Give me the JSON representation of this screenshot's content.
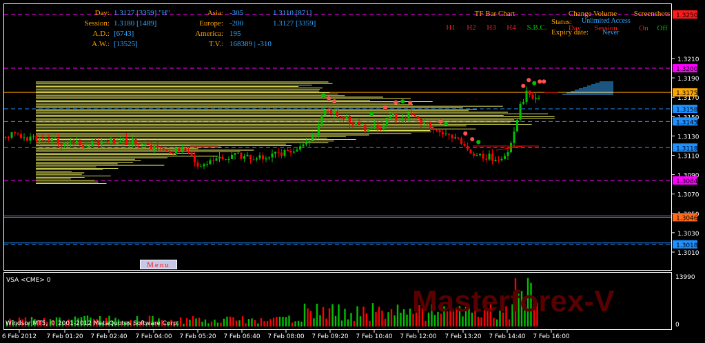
{
  "info_panel": {
    "day_label": "Day:",
    "day_value": "1.3127  [3359]  \"H\"",
    "session_label": "Session:",
    "session_value": "1.3180  [1489]",
    "ad_label": "A.D.:",
    "ad_value": "[6743]",
    "aw_label": "A.W.:",
    "aw_value": "[13525]",
    "asia_label": "Asia:",
    "asia_value": "-305",
    "asia_extra": "1.3110 [871]",
    "europe_label": "Europe:",
    "europe_value": "-200",
    "europe_extra": "1.3127 [3359]",
    "america_label": "America:",
    "america_value": "195",
    "tv_label": "T.V.:",
    "tv_value": "168389 | -310"
  },
  "tf_panel": {
    "title": "TF Bar Chart",
    "buttons": [
      "H1",
      "H2",
      "H3",
      "H4",
      "S.B.C."
    ]
  },
  "right_panel": {
    "change_volume": "Change Volume",
    "screenshots": "Screenshots",
    "status_label": "Status:",
    "status_value": "Unlimited Access",
    "day": "Day",
    "session": "Session",
    "on": "On",
    "off": "Off",
    "expiry_label": "Expiry date:",
    "expiry_value": "Never"
  },
  "menu_button": "Menu",
  "indicator_title": "VSA <CME> 0",
  "copyright": "Windsor MT5, © 2001-2012 MetaQuotes Software Corp.",
  "watermark": "Masterforex-V",
  "price_axis": {
    "ticks": [
      "1.3210",
      "1.3190",
      "1.3170",
      "1.3150",
      "1.3130",
      "1.3110",
      "1.3090",
      "1.3070",
      "1.3050",
      "1.3030",
      "1.3010"
    ],
    "tags": [
      {
        "label": "1.3250",
        "color": "#ff1a1a"
      },
      {
        "label": "1.3200",
        "color": "#ff00ff"
      },
      {
        "label": "1.3175",
        "color": "#ffa500"
      },
      {
        "label": "1.3158",
        "color": "#1e90ff"
      },
      {
        "label": "1.3145",
        "color": "#1e90ff"
      },
      {
        "label": "1.3118",
        "color": "#1e90ff"
      },
      {
        "label": "1.3084",
        "color": "#ff00ff"
      },
      {
        "label": "1.3046",
        "color": "#ff6a1a"
      },
      {
        "label": "1.3018",
        "color": "#1e90ff"
      }
    ]
  },
  "volume_axis": {
    "top": "13990",
    "bottom": "0"
  },
  "time_axis": [
    "6 Feb 2012",
    "7 Feb 01:20",
    "7 Feb 02:40",
    "7 Feb 04:00",
    "7 Feb 05:20",
    "7 Feb 06:40",
    "7 Feb 08:00",
    "7 Feb 09:20",
    "7 Feb 10:40",
    "7 Feb 12:00",
    "7 Feb 13:20",
    "7 Feb 14:40",
    "7 Feb 16:00"
  ],
  "colors": {
    "background": "#000000",
    "axis_text": "#ffffff",
    "label_orange": "#ffa500",
    "value_blue": "#33a7ff",
    "bull": "#00c000",
    "bear": "#ff0000",
    "profile": "#ffff66",
    "watermark": "#5a0000"
  }
}
